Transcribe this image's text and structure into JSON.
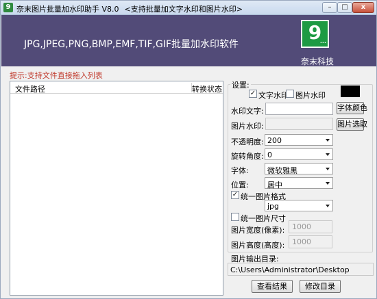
{
  "titlebar": {
    "app_icon_text": "9",
    "title": "奈末图片批量加水印助手 V8.0",
    "subtitle": "<支持批量加文字水印和图片水印>",
    "min_label": "–",
    "max_label": "□",
    "close_label": "x"
  },
  "banner": {
    "headline": "JPG,JPEG,PNG,BMP,EMF,TIF,GIF批量加水印软件",
    "logo_text": "9",
    "logo_dots": "...",
    "brand": "奈末科技"
  },
  "hint": "提示:支持文件直接拖入列表",
  "file_list": {
    "col_path": "文件路径",
    "col_status": "转换状态"
  },
  "settings": {
    "group_label": "设置:",
    "text_watermark": {
      "label": "文字水印",
      "checked": true
    },
    "image_watermark": {
      "label": "图片水印",
      "checked": false
    },
    "watermark_text_label": "水印文字:",
    "watermark_text_value": "",
    "font_color_button": "字体颜色",
    "image_watermark_label": "图片水印:",
    "image_select_button": "图片选取",
    "opacity_label": "不透明度:",
    "opacity_value": "200",
    "rotation_label": "旋转角度:",
    "rotation_value": "0",
    "font_label": "字体:",
    "font_value": "微软雅黑",
    "position_label": "位置:",
    "position_value": "居中",
    "unify_format": {
      "label": "统一图片格式",
      "checked": true
    },
    "format_value": "jpg",
    "unify_size": {
      "label": "统一图片尺寸",
      "checked": false
    },
    "width_label": "图片宽度(像素):",
    "width_value": "1000",
    "height_label": "图片高度(高度):",
    "height_value": "1000",
    "color_swatch": "#000000"
  },
  "output": {
    "label": "图片输出目录:",
    "path": "C:\\Users\\Administrator\\Desktop",
    "view_results_button": "查看结果",
    "change_dir_button": "修改目录"
  }
}
